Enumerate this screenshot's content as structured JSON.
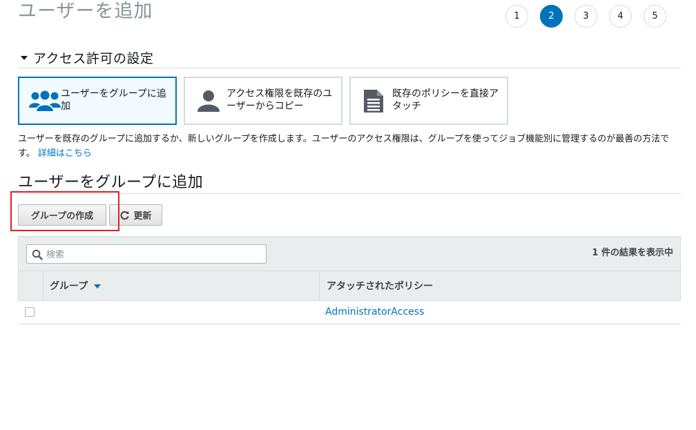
{
  "page": {
    "title": "ユーザーを追加",
    "steps": [
      "1",
      "2",
      "3",
      "4",
      "5"
    ],
    "active_step": "2"
  },
  "permissions": {
    "section_title": "アクセス許可の設定",
    "options": [
      {
        "label": "ユーザーをグループに追加",
        "icon": "users-group-icon",
        "selected": true
      },
      {
        "label": "アクセス権限を既存のユーザーからコピー",
        "icon": "user-icon",
        "selected": false
      },
      {
        "label": "既存のポリシーを直接アタッチ",
        "icon": "document-icon",
        "selected": false
      }
    ],
    "description": "ユーザーを既存のグループに追加するか、新しいグループを作成します。ユーザーのアクセス権限は、グループを使ってジョブ機能別に管理するのが最善の方法です。",
    "learn_more": "詳細はこちら"
  },
  "group_section": {
    "title": "ユーザーをグループに追加",
    "create_group_label": "グループの作成",
    "refresh_label": "更新"
  },
  "grid": {
    "search_placeholder": "検索",
    "result_count": "1 件の結果を表示中",
    "columns": [
      "グループ",
      "アタッチされたポリシー"
    ],
    "rows": [
      {
        "group": "",
        "policy": "AdministratorAccess",
        "checked": false
      }
    ]
  },
  "colors": {
    "accent": "#0073bb",
    "highlight": "#e0201e",
    "title_gray": "#879596"
  }
}
